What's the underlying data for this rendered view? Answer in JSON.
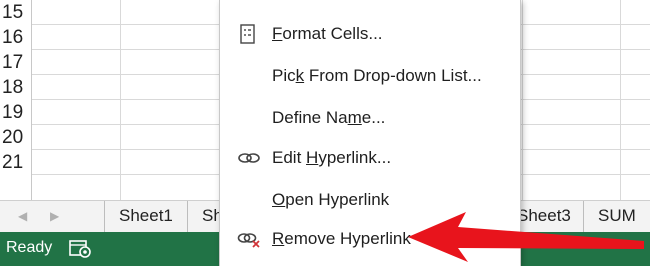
{
  "grid": {
    "row_numbers": [
      "15",
      "16",
      "17",
      "18",
      "19",
      "20",
      "21"
    ]
  },
  "sheet_tabs": [
    "Sheet1",
    "Sh",
    "Sheet3",
    "SUM"
  ],
  "status_bar": {
    "ready_label": "Ready",
    "color": "#217346"
  },
  "context_menu": {
    "items": [
      {
        "pre": "",
        "u": "F",
        "post": "ormat Cells...",
        "icon": "format-cells-icon"
      },
      {
        "pre": "Pic",
        "u": "k",
        "post": " From Drop-down List...",
        "icon": ""
      },
      {
        "pre": "Define Na",
        "u": "m",
        "post": "e...",
        "icon": ""
      },
      {
        "pre": "Edit ",
        "u": "H",
        "post": "yperlink...",
        "icon": "edit-hyperlink-icon"
      },
      {
        "pre": "",
        "u": "O",
        "post": "pen Hyperlink",
        "icon": ""
      },
      {
        "pre": "",
        "u": "R",
        "post": "emove Hyperlink",
        "icon": "remove-hyperlink-icon"
      }
    ]
  },
  "annotation": {
    "arrow_color": "#e8141c"
  }
}
